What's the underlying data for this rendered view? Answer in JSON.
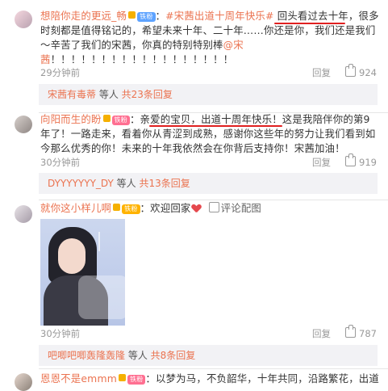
{
  "comments": [
    {
      "user": "想陪你走的更远_畅",
      "badge": "铁粉",
      "text_prefix": "：",
      "topic": "#宋茜出道十周年快乐#",
      "text_rest": " 回头看过去十年，很多时刻都是值得铭记的，希望未来十年、二十年……你还是你，我们还是我们～辛苦了我们的宋茜，你真的特别特别棒",
      "mention": "@宋茜",
      "text_tail": "！！！！！！！！！！！！！！！！！！",
      "time": "29分钟前",
      "reply_label": "回复",
      "likes": "924"
    },
    {
      "user": "向阳而生的盼",
      "badge": "铁粉",
      "text_body": "：亲爱的宝贝，出道十周年快乐！这是我陪伴你的第9年了！一路走来，看着你从青涩到成熟，感谢你这些年的努力让我们看到如今那么优秀的你！未来的十年我依然会在你背后支持你！宋茜加油！",
      "time": "30分钟前",
      "reply_label": "回复",
      "likes": "919"
    },
    {
      "user": "就你这小样儿啊",
      "badge": "铁粉",
      "text_body": "：欢迎回家",
      "pic_label": "评论配图",
      "time": "30分钟前",
      "reply_label": "回复",
      "likes": "787"
    },
    {
      "user": "恩恩不是emmm",
      "badge": "铁粉",
      "text_body": "：以梦为马，不负韶华，十年共同，沿路繁花，出道"
    }
  ],
  "subs": [
    {
      "name": "宋茜有毒蒂",
      "middle": " 等人 ",
      "count": "共23条回复"
    },
    {
      "name": "DYYYYYYY_DY",
      "middle": " 等人 ",
      "count": "共13条回复"
    },
    {
      "name": "吧唧吧唧轰隆轰隆",
      "middle": " 等人 ",
      "count": "共8条回复"
    }
  ]
}
